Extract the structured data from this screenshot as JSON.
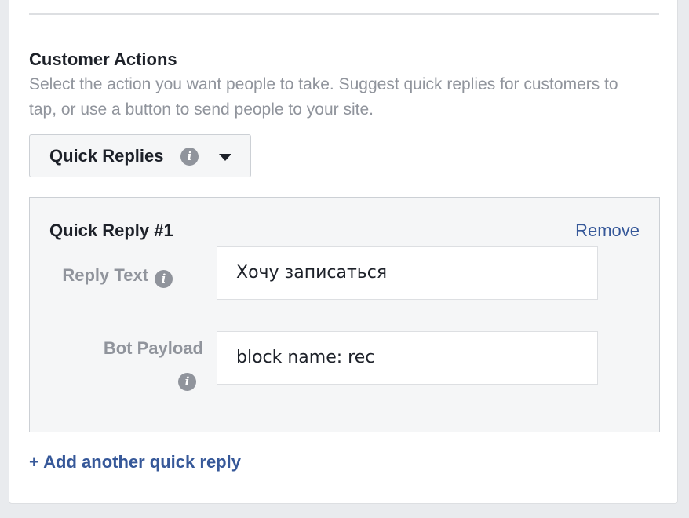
{
  "section": {
    "title": "Customer Actions",
    "description": "Select the action you want people to take. Suggest quick replies for customers to tap, or use a button to send people to your site."
  },
  "action_dropdown": {
    "selected": "Quick Replies",
    "info_icon": "info-icon",
    "caret_icon": "chevron-down-icon"
  },
  "quick_reply": {
    "title": "Quick Reply #1",
    "remove_label": "Remove",
    "reply_text": {
      "label": "Reply Text",
      "value": "Хочу записаться"
    },
    "bot_payload": {
      "label": "Bot Payload",
      "value": "block name: rec"
    }
  },
  "add_quick_reply_label": "+ Add another quick reply",
  "colors": {
    "link": "#365899",
    "muted_text": "#90949c",
    "primary_text": "#1d2129",
    "panel_bg": "#f5f6f7",
    "border": "#ccd0d5"
  }
}
